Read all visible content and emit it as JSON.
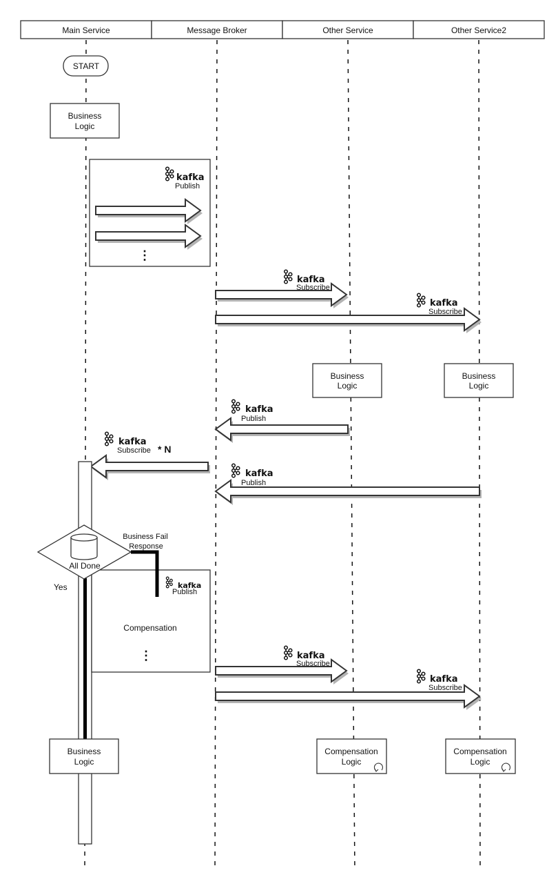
{
  "lanes": [
    {
      "id": "main",
      "label": "Main Service"
    },
    {
      "id": "broker",
      "label": "Message Broker"
    },
    {
      "id": "other",
      "label": "Other Service"
    },
    {
      "id": "other2",
      "label": "Other Service2"
    }
  ],
  "start_label": "START",
  "kafka_brand": "kafka",
  "boxes": {
    "main_logic_1": {
      "line1": "Business",
      "line2": "Logic"
    },
    "other_logic": {
      "line1": "Business",
      "line2": "Logic"
    },
    "other2_logic": {
      "line1": "Business",
      "line2": "Logic"
    },
    "main_logic_2": {
      "line1": "Business",
      "line2": "Logic"
    },
    "other_comp": {
      "line1": "Compensation",
      "line2": "Logic"
    },
    "other2_comp": {
      "line1": "Compensation",
      "line2": "Logic"
    }
  },
  "labels": {
    "publish": "Publish",
    "subscribe": "Subscribe",
    "multiplier": "* N",
    "ellipsis": "⋮",
    "decision": "All Done",
    "yes": "Yes",
    "fail_line1": "Business Fail",
    "fail_line2": "Response",
    "compensation": "Compensation"
  },
  "colors": {
    "stroke": "#333333",
    "shadow": "#b3b3b3",
    "text": "#111111"
  }
}
